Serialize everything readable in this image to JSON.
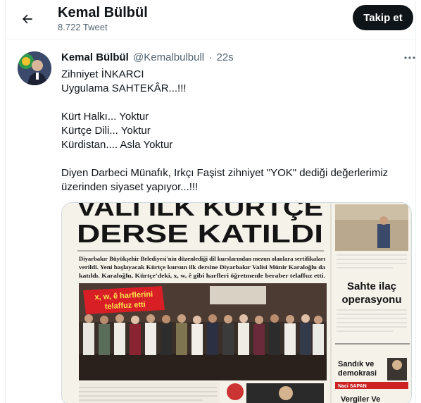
{
  "header": {
    "name": "Kemal Bülbül",
    "tweet_count": "8.722 Tweet",
    "follow_label": "Takip et"
  },
  "tweet": {
    "author_name": "Kemal Bülbül",
    "handle": "@Kemalbulbull",
    "separator": "·",
    "time": "22s",
    "lines": [
      "Zihniyet İNKARCI",
      "Uygulama SAHTEKÂR...!!!",
      "",
      "Kürt Halkı... Yoktur",
      "Kürtçe Dili... Yoktur",
      "Kürdistan.... Asla Yoktur",
      "",
      "Diyen Darbeci Münafık, Irkçı Faşist zihniyet \"YOK\" dediği değerlerimiz",
      "üzerinden siyaset yapıyor...!!!"
    ]
  },
  "newspaper": {
    "headline_top": "VALİ İLK KÜRTÇE",
    "headline": "DERSE KATILDI",
    "lead": [
      "Diyarbakır Büyükşehir Belediyesi'nin düzenlediği dil kurslarından mezun olanlara sertifikaları",
      "verildi. Yeni başlayacak Kürtçe kursun ilk dersine Diyarbakır Valisi Münir Karaloğlu da",
      "katıldı. Karaloğlu, Kürtçe'deki, x, w, ê gibi harfleri öğretmenle beraber telaffuz etti."
    ],
    "banner_line1": "x, w, ê harflerini",
    "banner_line2": "telaffuz etti",
    "side_headline_1": "Sahte ilaç",
    "side_headline_2": "operasyonu",
    "side_box_1": "Sandık ve",
    "side_box_2": "demokrasi",
    "side_box_author": "Naci SAPAN",
    "side_bottom": "Vergiler Ve"
  },
  "icons": {
    "back": "arrow-left-icon",
    "more": "more-horizontal-icon"
  },
  "colors": {
    "follow_bg": "#0f1419",
    "muted_text": "#536471",
    "banner_red": "#d81f26"
  }
}
